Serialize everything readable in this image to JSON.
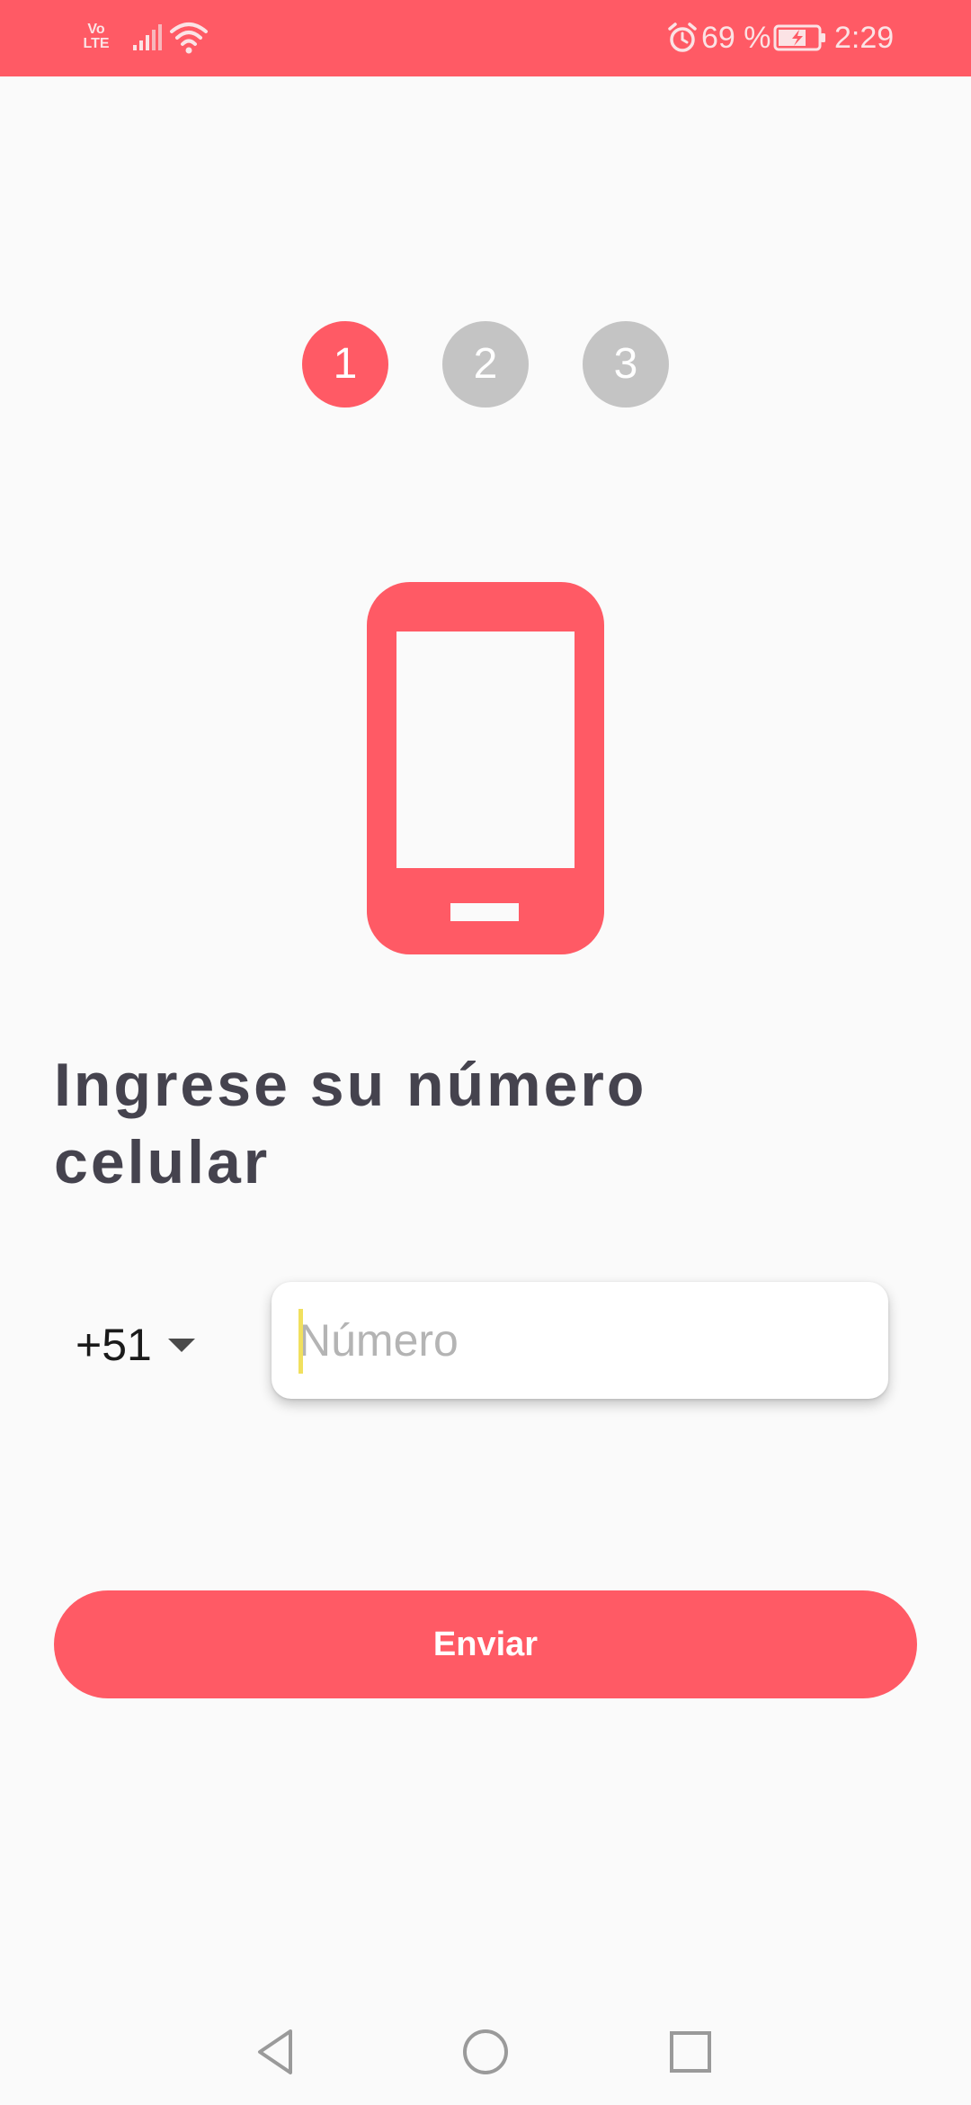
{
  "status_bar": {
    "volte_line1": "Vo",
    "volte_line2": "LTE",
    "battery_percent": "69 %",
    "time": "2:29",
    "background_color": "#ff5a65",
    "icons": [
      "volte-icon",
      "signal-icon",
      "wifi-icon",
      "alarm-icon",
      "battery-charging-icon"
    ]
  },
  "steps": {
    "items": [
      {
        "label": "1",
        "state": "active"
      },
      {
        "label": "2",
        "state": "inactive"
      },
      {
        "label": "3",
        "state": "inactive"
      }
    ],
    "active_color": "#ff5a65",
    "inactive_color": "#c4c4c4"
  },
  "illustration": {
    "icon": "smartphone-icon",
    "color": "#ff5a65"
  },
  "heading": {
    "text": "Ingrese su número celular"
  },
  "phone_form": {
    "country_code": "+51",
    "number_value": "",
    "number_placeholder": "Número",
    "submit_label": "Enviar"
  },
  "navigation": {
    "buttons": [
      "back-icon",
      "home-icon",
      "recents-icon"
    ]
  },
  "colors": {
    "accent": "#ff5a65",
    "heading_text": "#45434e",
    "background": "#fafafa"
  }
}
